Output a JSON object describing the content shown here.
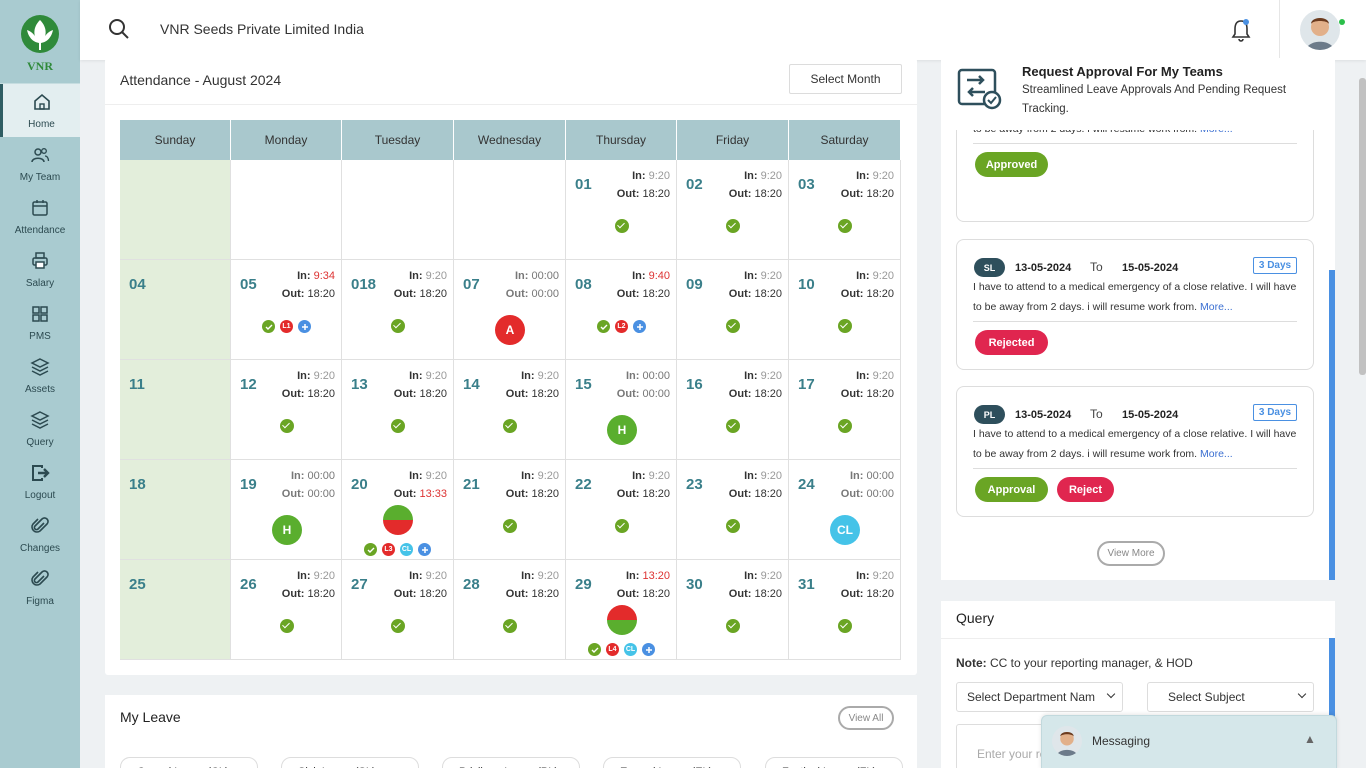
{
  "brand": {
    "logo_text": "VNR",
    "company": "VNR Seeds Private Limited India"
  },
  "nav": [
    {
      "label": "Home",
      "icon": "home-icon",
      "active": true
    },
    {
      "label": "My Team",
      "icon": "team-icon"
    },
    {
      "label": "Attendance",
      "icon": "calendar-icon"
    },
    {
      "label": "Salary",
      "icon": "printer-icon"
    },
    {
      "label": "PMS",
      "icon": "grid-icon"
    },
    {
      "label": "Assets",
      "icon": "layers-icon"
    },
    {
      "label": "Query",
      "icon": "layers-icon"
    },
    {
      "label": "Logout",
      "icon": "logout-icon"
    },
    {
      "label": "Changes",
      "icon": "paperclip-icon"
    },
    {
      "label": "Figma",
      "icon": "paperclip-icon"
    }
  ],
  "attendance": {
    "title": "Attendance - August 2024",
    "select_month": "Select Month",
    "weekdays": [
      "Sunday",
      "Monday",
      "Tuesday",
      "Wednesday",
      "Thursday",
      "Friday",
      "Saturday"
    ],
    "in_label": "In:",
    "out_label": "Out:",
    "rows": [
      [
        null,
        null,
        null,
        null,
        {
          "d": "01",
          "in": "9:20",
          "out": "18:20",
          "check": true
        },
        {
          "d": "02",
          "in": "9:20",
          "out": "18:20",
          "check": true
        },
        {
          "d": "03",
          "in": "9:20",
          "out": "18:20",
          "check": true
        }
      ],
      [
        {
          "d": "04",
          "sun": true
        },
        {
          "d": "05",
          "in": "9:34",
          "out": "18:20",
          "inRed": true,
          "icons": [
            "check",
            "L1",
            "plus"
          ]
        },
        {
          "d": "018",
          "in": "9:20",
          "out": "18:20",
          "check": true
        },
        {
          "d": "07",
          "in": "00:00",
          "out": "00:00",
          "grey": true,
          "big": {
            "text": "A",
            "color": "#e32b2b"
          }
        },
        {
          "d": "08",
          "in": "9:40",
          "out": "18:20",
          "inRed": true,
          "icons": [
            "check",
            "L2",
            "plus"
          ]
        },
        {
          "d": "09",
          "in": "9:20",
          "out": "18:20",
          "check": true
        },
        {
          "d": "10",
          "in": "9:20",
          "out": "18:20",
          "check": true
        }
      ],
      [
        {
          "d": "11",
          "sun": true
        },
        {
          "d": "12",
          "in": "9:20",
          "out": "18:20",
          "check": true
        },
        {
          "d": "13",
          "in": "9:20",
          "out": "18:20",
          "check": true
        },
        {
          "d": "14",
          "in": "9:20",
          "out": "18:20",
          "check": true
        },
        {
          "d": "15",
          "in": "00:00",
          "out": "00:00",
          "grey": true,
          "big": {
            "text": "H",
            "color": "#5aae2e"
          }
        },
        {
          "d": "16",
          "in": "9:20",
          "out": "18:20",
          "check": true
        },
        {
          "d": "17",
          "in": "9:20",
          "out": "18:20",
          "check": true
        }
      ],
      [
        {
          "d": "18",
          "sun": true
        },
        {
          "d": "19",
          "in": "00:00",
          "out": "00:00",
          "grey": true,
          "big": {
            "text": "H",
            "color": "#5aae2e"
          }
        },
        {
          "d": "20",
          "in": "9:20",
          "out": "13:33",
          "outRed": true,
          "half": "green-red",
          "icons": [
            "check",
            "L3",
            "CL",
            "plus"
          ]
        },
        {
          "d": "21",
          "in": "9:20",
          "out": "18:20",
          "check": true
        },
        {
          "d": "22",
          "in": "9:20",
          "out": "18:20",
          "check": true
        },
        {
          "d": "23",
          "in": "9:20",
          "out": "18:20",
          "check": true
        },
        {
          "d": "24",
          "in": "00:00",
          "out": "00:00",
          "grey": true,
          "big": {
            "text": "CL",
            "color": "#45c3e8"
          }
        }
      ],
      [
        {
          "d": "25",
          "sun": true
        },
        {
          "d": "26",
          "in": "9:20",
          "out": "18:20",
          "check": true
        },
        {
          "d": "27",
          "in": "9:20",
          "out": "18:20",
          "check": true
        },
        {
          "d": "28",
          "in": "9:20",
          "out": "18:20",
          "check": true
        },
        {
          "d": "29",
          "in": "13:20",
          "out": "18:20",
          "inRed": true,
          "half": "red-green",
          "icons": [
            "check",
            "L4",
            "CL",
            "plus"
          ]
        },
        {
          "d": "30",
          "in": "9:20",
          "out": "18:20",
          "check": true
        },
        {
          "d": "31",
          "in": "9:20",
          "out": "18:20",
          "check": true
        }
      ]
    ]
  },
  "approvals": {
    "title": "Request Approval For My Teams",
    "subtitle": "Streamlined Leave Approvals And Pending Request Tracking.",
    "cards": [
      {
        "desc": "I have to attend to a medical emergency of a close relative. I will have to be away from 2 days. i will resume work from.",
        "more": "More...",
        "buttons": [
          {
            "label": "Approved",
            "color": "green"
          }
        ]
      },
      {
        "type": "SL",
        "from": "13-05-2024",
        "to_label": "To",
        "to": "15-05-2024",
        "days": "3 Days",
        "desc": "I have to attend to a medical emergency of a close relative. I will have to be away from 2 days. i will resume work from.",
        "more": "More...",
        "buttons": [
          {
            "label": "Rejected",
            "color": "red"
          }
        ]
      },
      {
        "type": "PL",
        "from": "13-05-2024",
        "to_label": "To",
        "to": "15-05-2024",
        "days": "3 Days",
        "desc": "I have to attend to a medical emergency of a close relative. I will have to be away from 2 days. i will resume work from.",
        "more": "More...",
        "buttons": [
          {
            "label": "Approval",
            "color": "green"
          },
          {
            "label": "Reject",
            "color": "red"
          }
        ]
      }
    ],
    "view_more": "View More"
  },
  "query": {
    "title": "Query",
    "note_label": "Note:",
    "note": "CC to your reporting manager, & HOD",
    "department_select": "Select Department Nam",
    "subject_select": "Select Subject",
    "input_placeholder": "Enter your re"
  },
  "my_leave": {
    "title": "My Leave",
    "view_all": "View All",
    "tabs": [
      "Casual Leave (CL)",
      "Sick Leave (SL)",
      "Privilege Leave (PL)",
      "Earned Leave (EL)",
      "Festival Leave (FL)"
    ]
  },
  "messaging": {
    "label": "Messaging",
    "caret": "▲"
  },
  "colors": {
    "sidebar": "#a9cbd0",
    "calendar_header": "#a9c8cd",
    "sunday": "#e3eedb",
    "present": "#6aa524",
    "absent": "#e32b2b",
    "holiday": "#5aae2e",
    "casual": "#45c3e8",
    "accent": "#4a90e2"
  }
}
